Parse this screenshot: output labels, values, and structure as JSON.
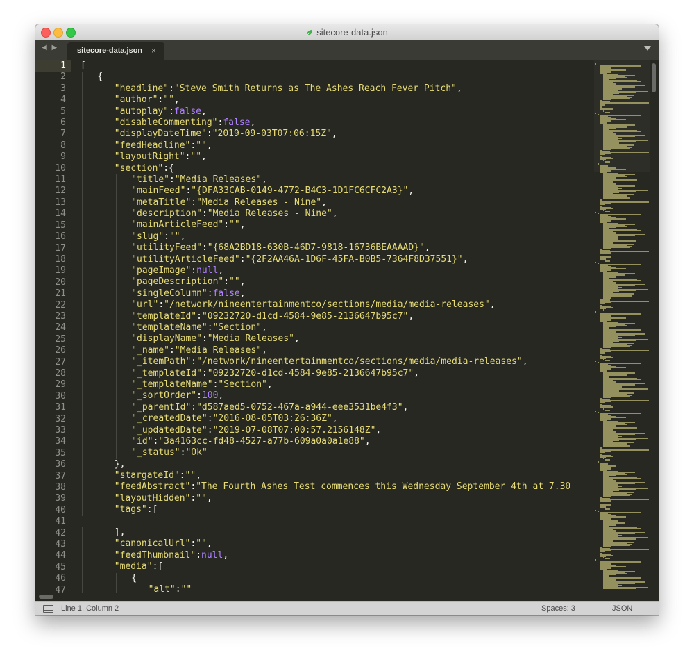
{
  "window": {
    "title": "sitecore-data.json"
  },
  "tabs": [
    {
      "label": "sitecore-data.json",
      "close": "×"
    }
  ],
  "status": {
    "position": "Line 1, Column 2",
    "spaces": "Spaces: 3",
    "syntax": "JSON"
  },
  "colors": {
    "background": "#272822",
    "string": "#e6db74",
    "constant": "#ae81ff",
    "text": "#f8f8f2",
    "line_number": "#90908a"
  },
  "line_numbers": [
    "1",
    "2",
    "3",
    "4",
    "5",
    "6",
    "7",
    "8",
    "9",
    "10",
    "11",
    "12",
    "13",
    "14",
    "15",
    "16",
    "17",
    "18",
    "19",
    "20",
    "21",
    "22",
    "23",
    "24",
    "25",
    "26",
    "27",
    "28",
    "29",
    "30",
    "31",
    "32",
    "33",
    "34",
    "35",
    "36",
    "37",
    "38",
    "39",
    "40",
    "41",
    "42",
    "43",
    "44",
    "45",
    "46",
    "47"
  ],
  "code_lines": [
    {
      "indent": 0,
      "tokens": [
        [
          "p",
          "["
        ]
      ]
    },
    {
      "indent": 1,
      "tokens": [
        [
          "p",
          "{"
        ]
      ]
    },
    {
      "indent": 2,
      "tokens": [
        [
          "s",
          "\"headline\""
        ],
        [
          "p",
          ":"
        ],
        [
          "s",
          "\"Steve Smith Returns as The Ashes Reach Fever Pitch\""
        ],
        [
          "p",
          ","
        ]
      ]
    },
    {
      "indent": 2,
      "tokens": [
        [
          "s",
          "\"author\""
        ],
        [
          "p",
          ":"
        ],
        [
          "s",
          "\"\""
        ],
        [
          "p",
          ","
        ]
      ]
    },
    {
      "indent": 2,
      "tokens": [
        [
          "s",
          "\"autoplay\""
        ],
        [
          "p",
          ":"
        ],
        [
          "k",
          "false"
        ],
        [
          "p",
          ","
        ]
      ]
    },
    {
      "indent": 2,
      "tokens": [
        [
          "s",
          "\"disableCommenting\""
        ],
        [
          "p",
          ":"
        ],
        [
          "k",
          "false"
        ],
        [
          "p",
          ","
        ]
      ]
    },
    {
      "indent": 2,
      "tokens": [
        [
          "s",
          "\"displayDateTime\""
        ],
        [
          "p",
          ":"
        ],
        [
          "s",
          "\"2019-09-03T07:06:15Z\""
        ],
        [
          "p",
          ","
        ]
      ]
    },
    {
      "indent": 2,
      "tokens": [
        [
          "s",
          "\"feedHeadline\""
        ],
        [
          "p",
          ":"
        ],
        [
          "s",
          "\"\""
        ],
        [
          "p",
          ","
        ]
      ]
    },
    {
      "indent": 2,
      "tokens": [
        [
          "s",
          "\"layoutRight\""
        ],
        [
          "p",
          ":"
        ],
        [
          "s",
          "\"\""
        ],
        [
          "p",
          ","
        ]
      ]
    },
    {
      "indent": 2,
      "tokens": [
        [
          "s",
          "\"section\""
        ],
        [
          "p",
          ":{"
        ]
      ]
    },
    {
      "indent": 3,
      "tokens": [
        [
          "s",
          "\"title\""
        ],
        [
          "p",
          ":"
        ],
        [
          "s",
          "\"Media Releases\""
        ],
        [
          "p",
          ","
        ]
      ]
    },
    {
      "indent": 3,
      "tokens": [
        [
          "s",
          "\"mainFeed\""
        ],
        [
          "p",
          ":"
        ],
        [
          "s",
          "\"{DFA33CAB-0149-4772-B4C3-1D1FC6CFC2A3}\""
        ],
        [
          "p",
          ","
        ]
      ]
    },
    {
      "indent": 3,
      "tokens": [
        [
          "s",
          "\"metaTitle\""
        ],
        [
          "p",
          ":"
        ],
        [
          "s",
          "\"Media Releases - Nine\""
        ],
        [
          "p",
          ","
        ]
      ]
    },
    {
      "indent": 3,
      "tokens": [
        [
          "s",
          "\"description\""
        ],
        [
          "p",
          ":"
        ],
        [
          "s",
          "\"Media Releases - Nine\""
        ],
        [
          "p",
          ","
        ]
      ]
    },
    {
      "indent": 3,
      "tokens": [
        [
          "s",
          "\"mainArticleFeed\""
        ],
        [
          "p",
          ":"
        ],
        [
          "s",
          "\"\""
        ],
        [
          "p",
          ","
        ]
      ]
    },
    {
      "indent": 3,
      "tokens": [
        [
          "s",
          "\"slug\""
        ],
        [
          "p",
          ":"
        ],
        [
          "s",
          "\"\""
        ],
        [
          "p",
          ","
        ]
      ]
    },
    {
      "indent": 3,
      "tokens": [
        [
          "s",
          "\"utilityFeed\""
        ],
        [
          "p",
          ":"
        ],
        [
          "s",
          "\"{68A2BD18-630B-46D7-9818-16736BEAAAAD}\""
        ],
        [
          "p",
          ","
        ]
      ]
    },
    {
      "indent": 3,
      "tokens": [
        [
          "s",
          "\"utilityArticleFeed\""
        ],
        [
          "p",
          ":"
        ],
        [
          "s",
          "\"{2F2AA46A-1D6F-45FA-B0B5-7364F8D37551}\""
        ],
        [
          "p",
          ","
        ]
      ]
    },
    {
      "indent": 3,
      "tokens": [
        [
          "s",
          "\"pageImage\""
        ],
        [
          "p",
          ":"
        ],
        [
          "k",
          "null"
        ],
        [
          "p",
          ","
        ]
      ]
    },
    {
      "indent": 3,
      "tokens": [
        [
          "s",
          "\"pageDescription\""
        ],
        [
          "p",
          ":"
        ],
        [
          "s",
          "\"\""
        ],
        [
          "p",
          ","
        ]
      ]
    },
    {
      "indent": 3,
      "tokens": [
        [
          "s",
          "\"singleColumn\""
        ],
        [
          "p",
          ":"
        ],
        [
          "k",
          "false"
        ],
        [
          "p",
          ","
        ]
      ]
    },
    {
      "indent": 3,
      "tokens": [
        [
          "s",
          "\"url\""
        ],
        [
          "p",
          ":"
        ],
        [
          "s",
          "\"/network/nineentertainmentco/sections/media/media-releases\""
        ],
        [
          "p",
          ","
        ]
      ]
    },
    {
      "indent": 3,
      "tokens": [
        [
          "s",
          "\"templateId\""
        ],
        [
          "p",
          ":"
        ],
        [
          "s",
          "\"09232720-d1cd-4584-9e85-2136647b95c7\""
        ],
        [
          "p",
          ","
        ]
      ]
    },
    {
      "indent": 3,
      "tokens": [
        [
          "s",
          "\"templateName\""
        ],
        [
          "p",
          ":"
        ],
        [
          "s",
          "\"Section\""
        ],
        [
          "p",
          ","
        ]
      ]
    },
    {
      "indent": 3,
      "tokens": [
        [
          "s",
          "\"displayName\""
        ],
        [
          "p",
          ":"
        ],
        [
          "s",
          "\"Media Releases\""
        ],
        [
          "p",
          ","
        ]
      ]
    },
    {
      "indent": 3,
      "tokens": [
        [
          "s",
          "\"_name\""
        ],
        [
          "p",
          ":"
        ],
        [
          "s",
          "\"Media Releases\""
        ],
        [
          "p",
          ","
        ]
      ]
    },
    {
      "indent": 3,
      "tokens": [
        [
          "s",
          "\"_itemPath\""
        ],
        [
          "p",
          ":"
        ],
        [
          "s",
          "\"/network/nineentertainmentco/sections/media/media-releases\""
        ],
        [
          "p",
          ","
        ]
      ]
    },
    {
      "indent": 3,
      "tokens": [
        [
          "s",
          "\"_templateId\""
        ],
        [
          "p",
          ":"
        ],
        [
          "s",
          "\"09232720-d1cd-4584-9e85-2136647b95c7\""
        ],
        [
          "p",
          ","
        ]
      ]
    },
    {
      "indent": 3,
      "tokens": [
        [
          "s",
          "\"_templateName\""
        ],
        [
          "p",
          ":"
        ],
        [
          "s",
          "\"Section\""
        ],
        [
          "p",
          ","
        ]
      ]
    },
    {
      "indent": 3,
      "tokens": [
        [
          "s",
          "\"_sortOrder\""
        ],
        [
          "p",
          ":"
        ],
        [
          "k",
          "100"
        ],
        [
          "p",
          ","
        ]
      ]
    },
    {
      "indent": 3,
      "tokens": [
        [
          "s",
          "\"_parentId\""
        ],
        [
          "p",
          ":"
        ],
        [
          "s",
          "\"d587aed5-0752-467a-a944-eee3531be4f3\""
        ],
        [
          "p",
          ","
        ]
      ]
    },
    {
      "indent": 3,
      "tokens": [
        [
          "s",
          "\"_createdDate\""
        ],
        [
          "p",
          ":"
        ],
        [
          "s",
          "\"2016-08-05T03:26:36Z\""
        ],
        [
          "p",
          ","
        ]
      ]
    },
    {
      "indent": 3,
      "tokens": [
        [
          "s",
          "\"_updatedDate\""
        ],
        [
          "p",
          ":"
        ],
        [
          "s",
          "\"2019-07-08T07:00:57.2156148Z\""
        ],
        [
          "p",
          ","
        ]
      ]
    },
    {
      "indent": 3,
      "tokens": [
        [
          "s",
          "\"id\""
        ],
        [
          "p",
          ":"
        ],
        [
          "s",
          "\"3a4163cc-fd48-4527-a77b-609a0a0a1e88\""
        ],
        [
          "p",
          ","
        ]
      ]
    },
    {
      "indent": 3,
      "tokens": [
        [
          "s",
          "\"_status\""
        ],
        [
          "p",
          ":"
        ],
        [
          "s",
          "\"Ok\""
        ]
      ]
    },
    {
      "indent": 2,
      "tokens": [
        [
          "p",
          "},"
        ]
      ]
    },
    {
      "indent": 2,
      "tokens": [
        [
          "s",
          "\"stargateId\""
        ],
        [
          "p",
          ":"
        ],
        [
          "s",
          "\"\""
        ],
        [
          "p",
          ","
        ]
      ]
    },
    {
      "indent": 2,
      "tokens": [
        [
          "s",
          "\"feedAbstract\""
        ],
        [
          "p",
          ":"
        ],
        [
          "s",
          "\"The Fourth Ashes Test commences this Wednesday September 4th at 7.30"
        ]
      ]
    },
    {
      "indent": 2,
      "tokens": [
        [
          "s",
          "\"layoutHidden\""
        ],
        [
          "p",
          ":"
        ],
        [
          "s",
          "\"\""
        ],
        [
          "p",
          ","
        ]
      ]
    },
    {
      "indent": 2,
      "tokens": [
        [
          "s",
          "\"tags\""
        ],
        [
          "p",
          ":["
        ]
      ]
    },
    {
      "indent": 0,
      "tokens": []
    },
    {
      "indent": 2,
      "tokens": [
        [
          "p",
          "],"
        ]
      ]
    },
    {
      "indent": 2,
      "tokens": [
        [
          "s",
          "\"canonicalUrl\""
        ],
        [
          "p",
          ":"
        ],
        [
          "s",
          "\"\""
        ],
        [
          "p",
          ","
        ]
      ]
    },
    {
      "indent": 2,
      "tokens": [
        [
          "s",
          "\"feedThumbnail\""
        ],
        [
          "p",
          ":"
        ],
        [
          "k",
          "null"
        ],
        [
          "p",
          ","
        ]
      ]
    },
    {
      "indent": 2,
      "tokens": [
        [
          "s",
          "\"media\""
        ],
        [
          "p",
          ":["
        ]
      ]
    },
    {
      "indent": 3,
      "tokens": [
        [
          "p",
          "{"
        ]
      ]
    },
    {
      "indent": 4,
      "tokens": [
        [
          "s",
          "\"alt\""
        ],
        [
          "p",
          ":"
        ],
        [
          "s",
          "\"\""
        ]
      ]
    }
  ]
}
